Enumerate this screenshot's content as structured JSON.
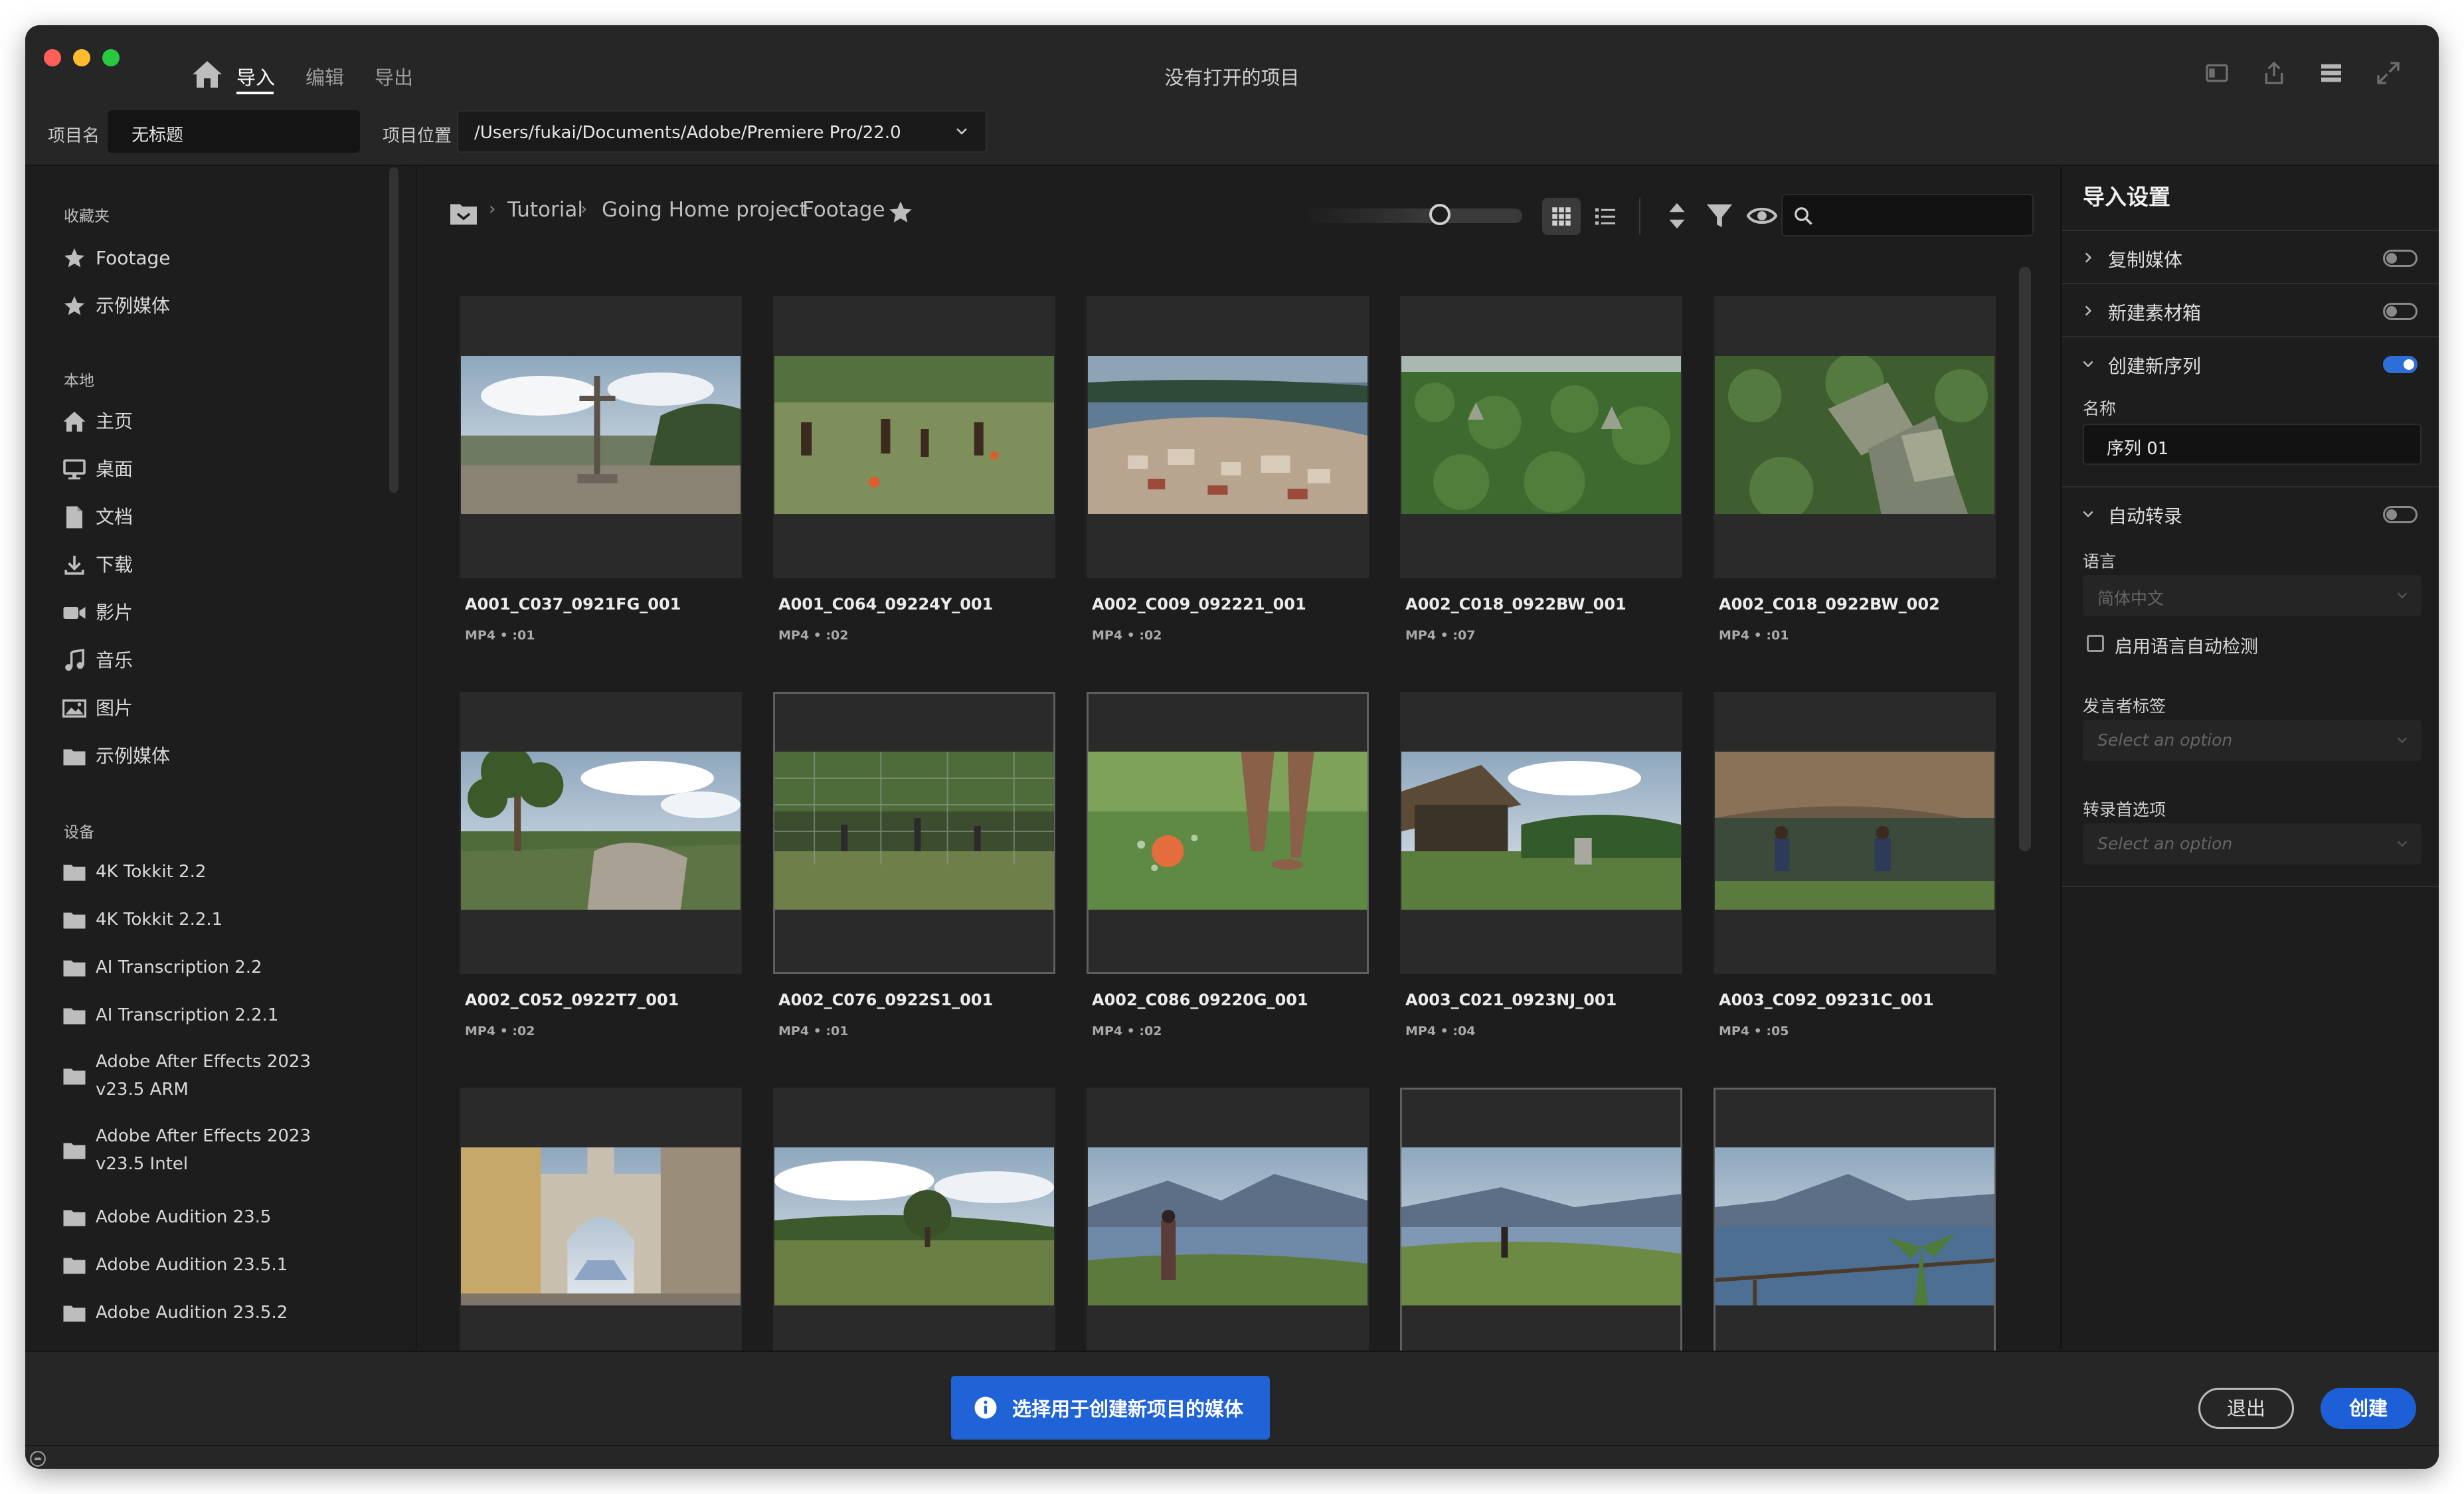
{
  "window": {
    "title": "没有打开的项目"
  },
  "nav": {
    "tabs": [
      {
        "label": "导入"
      },
      {
        "label": "编辑"
      },
      {
        "label": "导出"
      }
    ]
  },
  "project": {
    "name_label": "项目名",
    "name_value": "无标题",
    "location_label": "项目位置",
    "location_value": "/Users/fukai/Documents/Adobe/Premiere Pro/22.0"
  },
  "sidebar": {
    "favorites": {
      "title": "收藏夹",
      "items": [
        {
          "label": "Footage",
          "icon": "star-icon"
        },
        {
          "label": "示例媒体",
          "icon": "star-icon"
        }
      ]
    },
    "local": {
      "title": "本地",
      "items": [
        {
          "label": "主页",
          "icon": "home-icon"
        },
        {
          "label": "桌面",
          "icon": "desktop-icon"
        },
        {
          "label": "文档",
          "icon": "document-icon"
        },
        {
          "label": "下载",
          "icon": "download-icon"
        },
        {
          "label": "影片",
          "icon": "video-icon"
        },
        {
          "label": "音乐",
          "icon": "music-icon"
        },
        {
          "label": "图片",
          "icon": "image-icon"
        },
        {
          "label": "示例媒体",
          "icon": "folder-icon"
        }
      ]
    },
    "devices": {
      "title": "设备",
      "items": [
        {
          "label": "4K Tokkit 2.2"
        },
        {
          "label": "4K Tokkit 2.2.1"
        },
        {
          "label": "AI Transcription 2.2"
        },
        {
          "label": "AI Transcription 2.2.1"
        },
        {
          "label": "Adobe After Effects 2023 v23.5 ARM"
        },
        {
          "label": "Adobe After Effects 2023 v23.5 Intel"
        },
        {
          "label": "Adobe Audition 23.5"
        },
        {
          "label": "Adobe Audition 23.5.1"
        },
        {
          "label": "Adobe Audition 23.5.2"
        }
      ]
    }
  },
  "breadcrumb": {
    "items": [
      "Tutorial",
      "Going Home project",
      "Footage"
    ]
  },
  "clips": [
    {
      "name": "A001_C037_0921FG_001",
      "meta": "MP4 • :01",
      "thumb": "cross"
    },
    {
      "name": "A001_C064_09224Y_001",
      "meta": "MP4 • :02",
      "thumb": "soccer"
    },
    {
      "name": "A002_C009_092221_001",
      "meta": "MP4 • :02",
      "thumb": "town"
    },
    {
      "name": "A002_C018_0922BW_001",
      "meta": "MP4 • :07",
      "thumb": "jungle"
    },
    {
      "name": "A002_C018_0922BW_002",
      "meta": "MP4 • :01",
      "thumb": "ruins"
    },
    {
      "name": "A002_C052_0922T7_001",
      "meta": "MP4 • :02",
      "thumb": "tree"
    },
    {
      "name": "A002_C076_0922S1_001",
      "meta": "MP4 • :01",
      "thumb": "fence"
    },
    {
      "name": "A002_C086_09220G_001",
      "meta": "MP4 • :02",
      "thumb": "ball"
    },
    {
      "name": "A003_C021_0923NJ_001",
      "meta": "MP4 • :04",
      "thumb": "huts"
    },
    {
      "name": "A003_C092_09231C_001",
      "meta": "MP4 • :05",
      "thumb": "hut"
    },
    {
      "name": "",
      "meta": "",
      "thumb": "arch"
    },
    {
      "name": "",
      "meta": "",
      "thumb": "field"
    },
    {
      "name": "",
      "meta": "",
      "thumb": "lake1"
    },
    {
      "name": "",
      "meta": "",
      "thumb": "lake2"
    },
    {
      "name": "",
      "meta": "",
      "thumb": "lake3"
    }
  ],
  "import_settings": {
    "title": "导入设置",
    "copy_media": {
      "label": "复制媒体",
      "on": false
    },
    "new_bin": {
      "label": "新建素材箱",
      "on": false
    },
    "new_sequence": {
      "label": "创建新序列",
      "on": true
    },
    "name_label": "名称",
    "name_value": "序列 01",
    "auto_transcribe": {
      "label": "自动转录",
      "on": false
    },
    "language_label": "语言",
    "language_value": "简体中文",
    "auto_detect_label": "启用语言自动检测",
    "speaker_label": "发言者标签",
    "speaker_placeholder": "Select an option",
    "transcribe_pref_label": "转录首选项",
    "transcribe_pref_placeholder": "Select an option"
  },
  "footer": {
    "info": "选择用于创建新项目的媒体",
    "exit": "退出",
    "create": "创建"
  }
}
